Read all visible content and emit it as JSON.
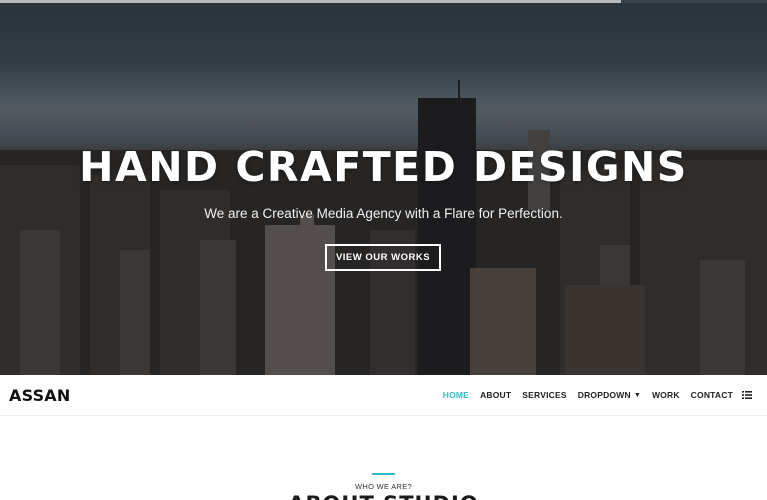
{
  "scroll_progress": 0.81,
  "hero": {
    "title": "HAND CRAFTED DESIGNS",
    "subtitle": "We are a Creative Media Agency with a Flare for Perfection.",
    "cta_label": "VIEW OUR WORKS",
    "background_image": "city-skyline-photo"
  },
  "navbar": {
    "logo": "ASSAN",
    "items": [
      {
        "label": "HOME",
        "active": true
      },
      {
        "label": "ABOUT"
      },
      {
        "label": "SERVICES"
      },
      {
        "label": "DROPDOWN",
        "has_caret": true
      },
      {
        "label": "WORK"
      },
      {
        "label": "CONTACT"
      }
    ],
    "menu_icon": "list-icon"
  },
  "about": {
    "kicker": "WHO WE ARE?",
    "title": "ABOUT STUDIO"
  },
  "colors": {
    "accent": "#35b8c4",
    "nav_text": "#222222",
    "hero_text": "#ffffff"
  }
}
